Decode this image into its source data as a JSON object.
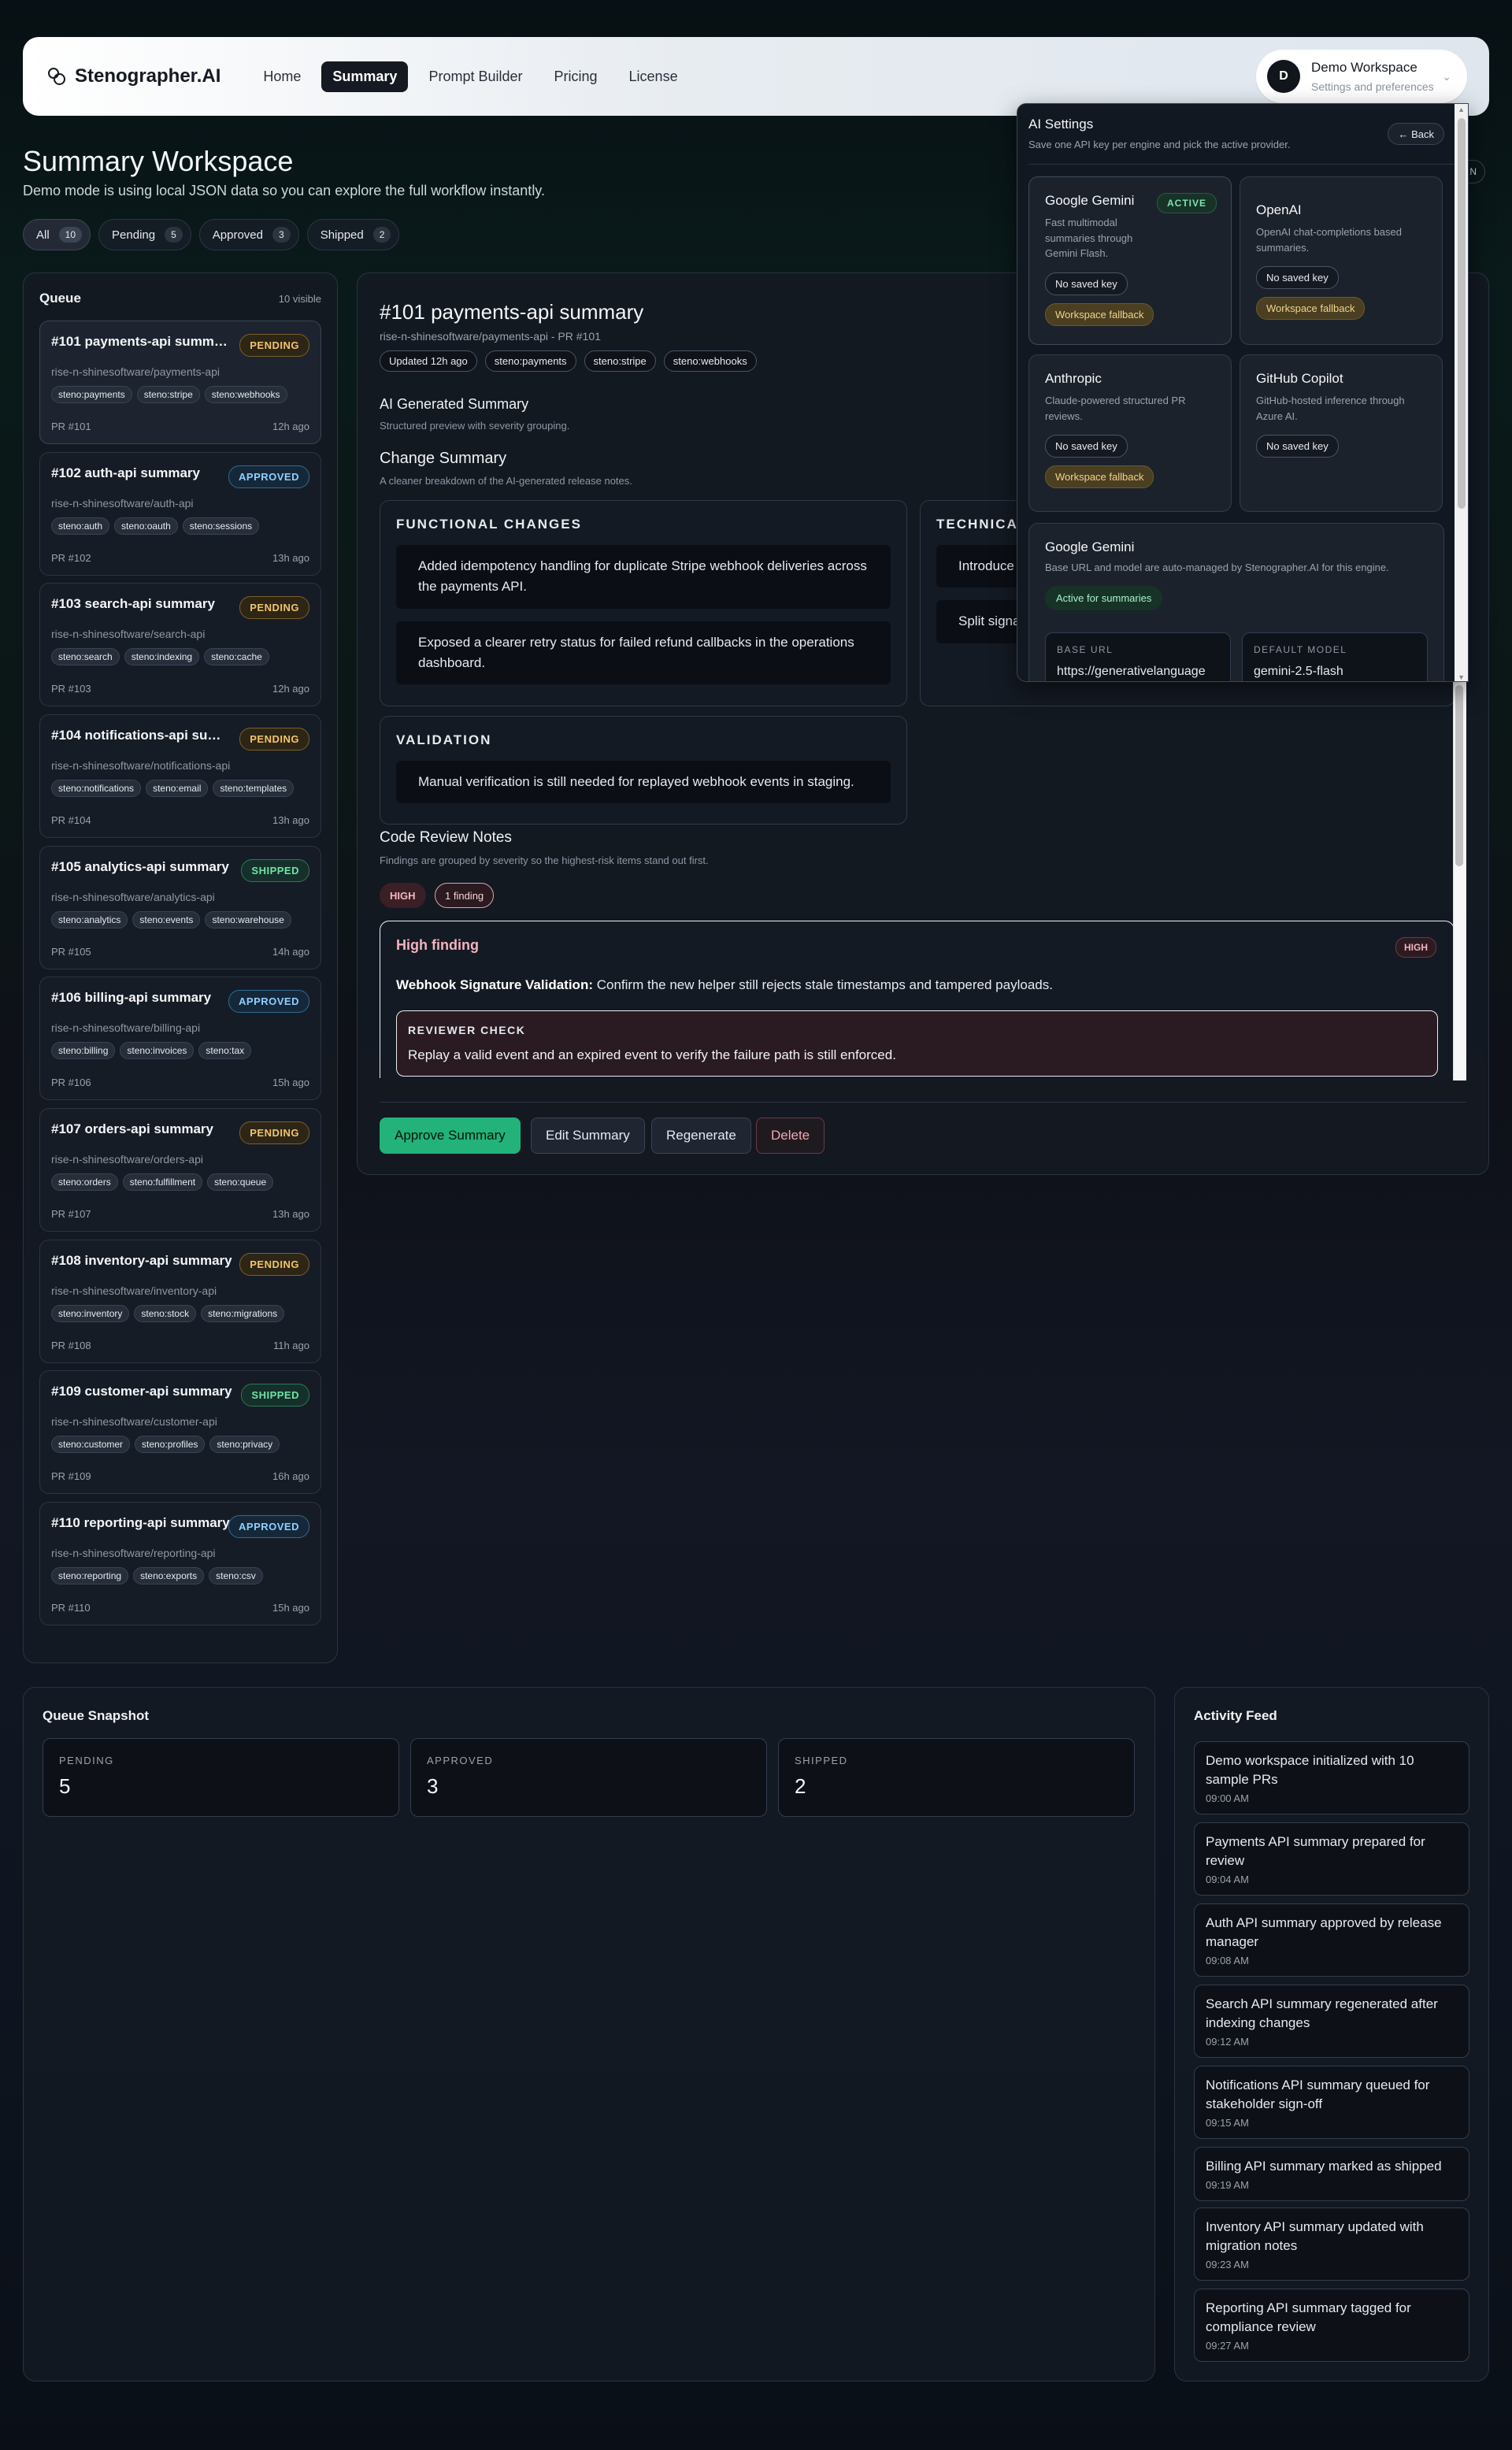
{
  "nav": {
    "brand": "Stenographer.AI",
    "links": [
      "Home",
      "Summary",
      "Prompt Builder",
      "Pricing",
      "License"
    ],
    "active": "Summary",
    "workspace": {
      "avatar": "D",
      "title": "Demo Workspace",
      "subtitle": "Settings and preferences"
    }
  },
  "header": {
    "title": "Summary Workspace",
    "subtitle": "Demo mode is using local JSON data so you can explore the full workflow instantly.",
    "right_pill": "N"
  },
  "filters": [
    {
      "label": "All",
      "count": "10"
    },
    {
      "label": "Pending",
      "count": "5"
    },
    {
      "label": "Approved",
      "count": "3"
    },
    {
      "label": "Shipped",
      "count": "2"
    }
  ],
  "queue": {
    "title": "Queue",
    "count": "10 visible",
    "items": [
      {
        "title": "#101 payments-api summary",
        "status": "PENDING",
        "repo": "rise-n-shinesoftware/payments-api",
        "tags": [
          "steno:payments",
          "steno:stripe",
          "steno:webhooks"
        ],
        "pr": "PR #101",
        "ago": "12h ago"
      },
      {
        "title": "#102 auth-api summary",
        "status": "APPROVED",
        "repo": "rise-n-shinesoftware/auth-api",
        "tags": [
          "steno:auth",
          "steno:oauth",
          "steno:sessions"
        ],
        "pr": "PR #102",
        "ago": "13h ago"
      },
      {
        "title": "#103 search-api summary",
        "status": "PENDING",
        "repo": "rise-n-shinesoftware/search-api",
        "tags": [
          "steno:search",
          "steno:indexing",
          "steno:cache"
        ],
        "pr": "PR #103",
        "ago": "12h ago"
      },
      {
        "title": "#104 notifications-api summary",
        "status": "PENDING",
        "repo": "rise-n-shinesoftware/notifications-api",
        "tags": [
          "steno:notifications",
          "steno:email",
          "steno:templates"
        ],
        "pr": "PR #104",
        "ago": "13h ago"
      },
      {
        "title": "#105 analytics-api summary",
        "status": "SHIPPED",
        "repo": "rise-n-shinesoftware/analytics-api",
        "tags": [
          "steno:analytics",
          "steno:events",
          "steno:warehouse"
        ],
        "pr": "PR #105",
        "ago": "14h ago"
      },
      {
        "title": "#106 billing-api summary",
        "status": "APPROVED",
        "repo": "rise-n-shinesoftware/billing-api",
        "tags": [
          "steno:billing",
          "steno:invoices",
          "steno:tax"
        ],
        "pr": "PR #106",
        "ago": "15h ago"
      },
      {
        "title": "#107 orders-api summary",
        "status": "PENDING",
        "repo": "rise-n-shinesoftware/orders-api",
        "tags": [
          "steno:orders",
          "steno:fulfillment",
          "steno:queue"
        ],
        "pr": "PR #107",
        "ago": "13h ago"
      },
      {
        "title": "#108 inventory-api summary",
        "status": "PENDING",
        "repo": "rise-n-shinesoftware/inventory-api",
        "tags": [
          "steno:inventory",
          "steno:stock",
          "steno:migrations"
        ],
        "pr": "PR #108",
        "ago": "11h ago"
      },
      {
        "title": "#109 customer-api summary",
        "status": "SHIPPED",
        "repo": "rise-n-shinesoftware/customer-api",
        "tags": [
          "steno:customer",
          "steno:profiles",
          "steno:privacy"
        ],
        "pr": "PR #109",
        "ago": "16h ago"
      },
      {
        "title": "#110 reporting-api summary",
        "status": "APPROVED",
        "repo": "rise-n-shinesoftware/reporting-api",
        "tags": [
          "steno:reporting",
          "steno:exports",
          "steno:csv"
        ],
        "pr": "PR #110",
        "ago": "15h ago"
      }
    ]
  },
  "detail": {
    "title": "#101 payments-api summary",
    "meta": "rise-n-shinesoftware/payments-api - PR #101",
    "tags": [
      "Updated 12h ago",
      "steno:payments",
      "steno:stripe",
      "steno:webhooks"
    ],
    "ai_heading": "AI Generated Summary",
    "ai_sub": "Structured preview with severity grouping.",
    "change_heading": "Change Summary",
    "change_sub": "A cleaner breakdown of the AI-generated release notes.",
    "functional": {
      "caption": "FUNCTIONAL CHANGES",
      "items": [
        "Added idempotency handling for duplicate Stripe webhook deliveries across the payments API.",
        "Exposed a clearer retry status for failed refund callbacks in the operations dashboard."
      ]
    },
    "technical": {
      "caption": "TECHNICAL",
      "items": [
        "Introduce format.",
        "Split signa branching"
      ]
    },
    "validation": {
      "caption": "VALIDATION",
      "items": [
        "Manual verification is still needed for replayed webhook events in staging."
      ]
    },
    "review_heading": "Code Review Notes",
    "review_sub": "Findings are grouped by severity so the highest-risk items stand out first.",
    "sev_high": "HIGH",
    "sev_count": "1 finding",
    "finding": {
      "title": "High finding",
      "badge": "HIGH",
      "label": "Webhook Signature Validation:",
      "body": "Confirm the new helper still rejects stale timestamps and tampered payloads.",
      "check_cap": "REVIEWER CHECK",
      "check_text": "Replay a valid event and an expired event to verify the failure path is still enforced."
    },
    "actions": {
      "approve": "Approve Summary",
      "edit": "Edit Summary",
      "regen": "Regenerate",
      "delete": "Delete"
    }
  },
  "ai_settings": {
    "title": "AI Settings",
    "subtitle": "Save one API key per engine and pick the active provider.",
    "back": "← Back",
    "providers": [
      {
        "name": "Google Gemini",
        "desc": "Fast multimodal summaries through Gemini Flash.",
        "key": "No saved key",
        "fallback": "Workspace fallback",
        "active": "ACTIVE"
      },
      {
        "name": "OpenAI",
        "desc": "OpenAI chat-completions based summaries.",
        "key": "No saved key",
        "fallback": "Workspace fallback"
      },
      {
        "name": "Anthropic",
        "desc": "Claude-powered structured PR reviews.",
        "key": "No saved key",
        "fallback": "Workspace fallback"
      },
      {
        "name": "GitHub Copilot",
        "desc": "GitHub-hosted inference through Azure AI.",
        "key": "No saved key"
      }
    ],
    "detail": {
      "name": "Google Gemini",
      "desc": "Base URL and model are auto-managed by Stenographer.AI for this engine.",
      "active": "Active for summaries",
      "base_url_label": "BASE URL",
      "base_url": "https://generativelanguage",
      "model_label": "DEFAULT MODEL",
      "model": "gemini-2.5-flash"
    }
  },
  "snapshot": {
    "title": "Queue Snapshot",
    "stats": [
      {
        "label": "PENDING",
        "value": "5"
      },
      {
        "label": "APPROVED",
        "value": "3"
      },
      {
        "label": "SHIPPED",
        "value": "2"
      }
    ]
  },
  "feed": {
    "title": "Activity Feed",
    "items": [
      {
        "text": "Demo workspace initialized with 10 sample PRs",
        "time": "09:00 AM"
      },
      {
        "text": "Payments API summary prepared for review",
        "time": "09:04 AM"
      },
      {
        "text": "Auth API summary approved by release manager",
        "time": "09:08 AM"
      },
      {
        "text": "Search API summary regenerated after indexing changes",
        "time": "09:12 AM"
      },
      {
        "text": "Notifications API summary queued for stakeholder sign-off",
        "time": "09:15 AM"
      },
      {
        "text": "Billing API summary marked as shipped",
        "time": "09:19 AM"
      },
      {
        "text": "Inventory API summary updated with migration notes",
        "time": "09:23 AM"
      },
      {
        "text": "Reporting API summary tagged for compliance review",
        "time": "09:27 AM"
      }
    ]
  }
}
